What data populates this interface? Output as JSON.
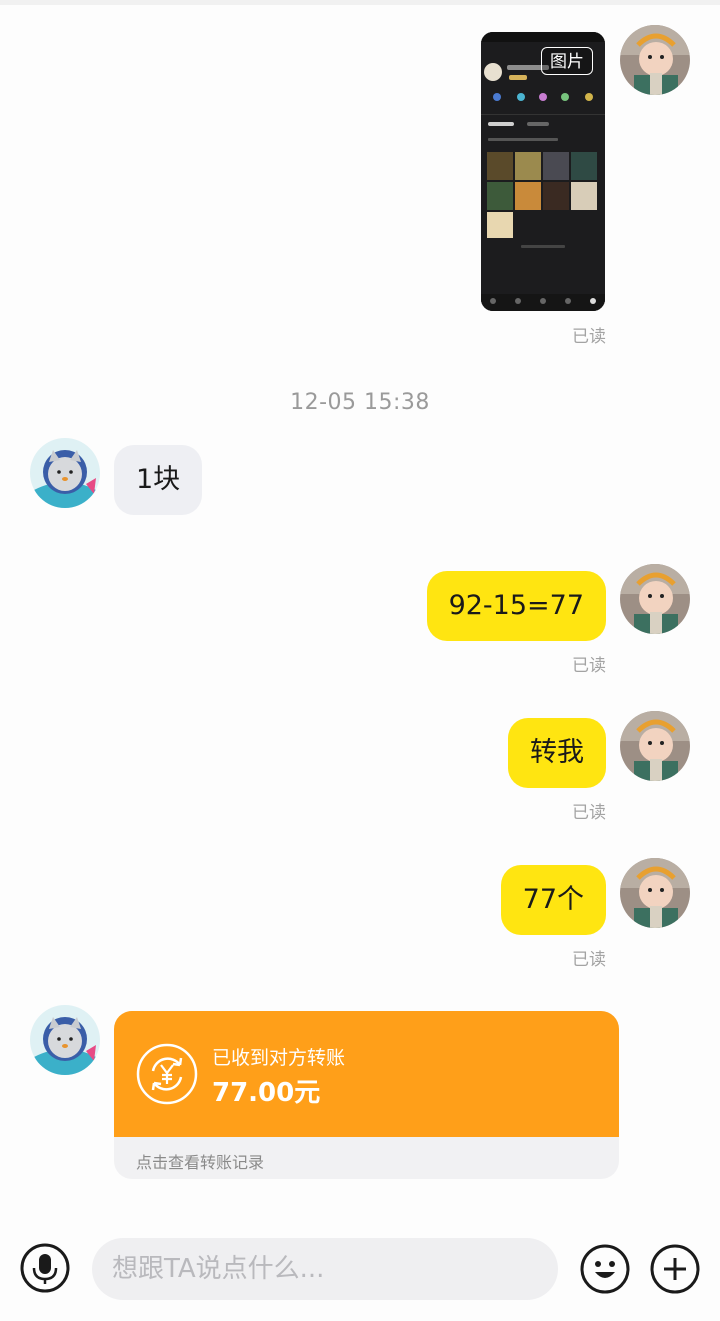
{
  "chat": {
    "image_message": {
      "badge_label": "图片",
      "read_label": "已读"
    },
    "timestamp": "12-05 15:38",
    "messages": [
      {
        "from": "other",
        "text": "1块"
      },
      {
        "from": "me",
        "text": "92-15=77",
        "read_label": "已读"
      },
      {
        "from": "me",
        "text": "转我",
        "read_label": "已读"
      },
      {
        "from": "me",
        "text": "77个",
        "read_label": "已读"
      }
    ],
    "transfer": {
      "status": "已收到对方转账",
      "amount": "77.00元",
      "link_label": "点击查看转账记录",
      "accent_color": "#ff9f19"
    }
  },
  "input_bar": {
    "placeholder": "想跟TA说点什么...",
    "voice_icon": "microphone-icon",
    "emoji_icon": "emoji-icon",
    "more_icon": "plus-icon"
  },
  "colors": {
    "my_bubble": "#ffe511",
    "other_bubble": "#eeeff3",
    "read_text": "#a3a3a3"
  }
}
